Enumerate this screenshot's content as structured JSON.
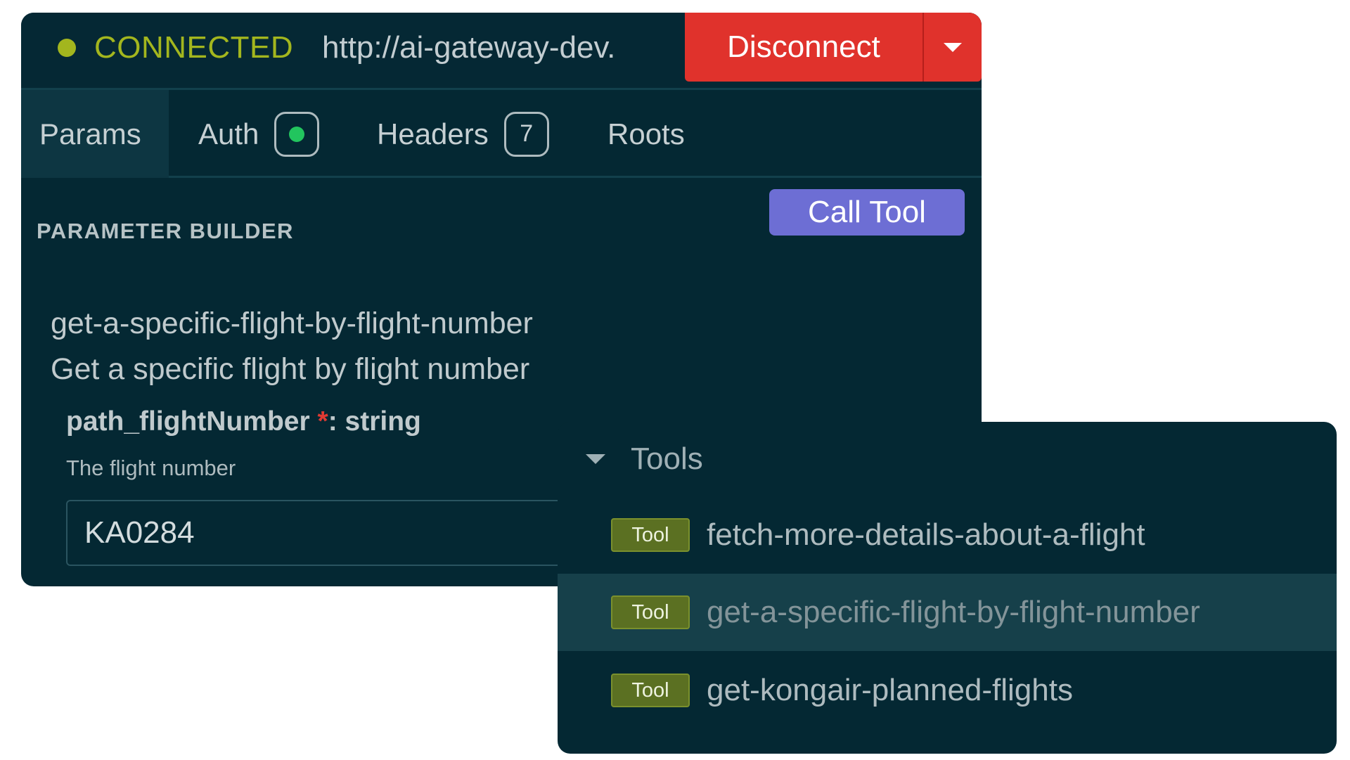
{
  "colors": {
    "panel_bg": "#042833",
    "status_connected": "#a3b61e",
    "disconnect_red": "#e0322c",
    "call_tool_purple": "#6d6ed4",
    "auth_dot_green": "#22c55e",
    "tool_badge_olive": "#5b7022"
  },
  "connection": {
    "status": "CONNECTED",
    "url": "http://ai-gateway-dev.",
    "disconnect_label": "Disconnect",
    "dropdown_icon": "caret-down-icon"
  },
  "tabs": [
    {
      "label": "Params",
      "active": true
    },
    {
      "label": "Auth",
      "badge_icon": "status-dot-icon"
    },
    {
      "label": "Headers",
      "badge": "7"
    },
    {
      "label": "Roots"
    }
  ],
  "parameter_builder": {
    "title": "PARAMETER BUILDER",
    "call_tool_label": "Call Tool",
    "tool_name": "get-a-specific-flight-by-flight-number",
    "tool_description": "Get a specific flight by flight number",
    "param": {
      "name": "path_flightNumber",
      "required_mark": "*",
      "type_suffix": ": string",
      "hint": "The flight number",
      "value": "KA0284"
    }
  },
  "tools_menu": {
    "title": "Tools",
    "badge_label": "Tool",
    "items": [
      {
        "label": "fetch-more-details-about-a-flight",
        "selected": false
      },
      {
        "label": "get-a-specific-flight-by-flight-number",
        "selected": true
      },
      {
        "label": "get-kongair-planned-flights",
        "selected": false
      }
    ]
  }
}
